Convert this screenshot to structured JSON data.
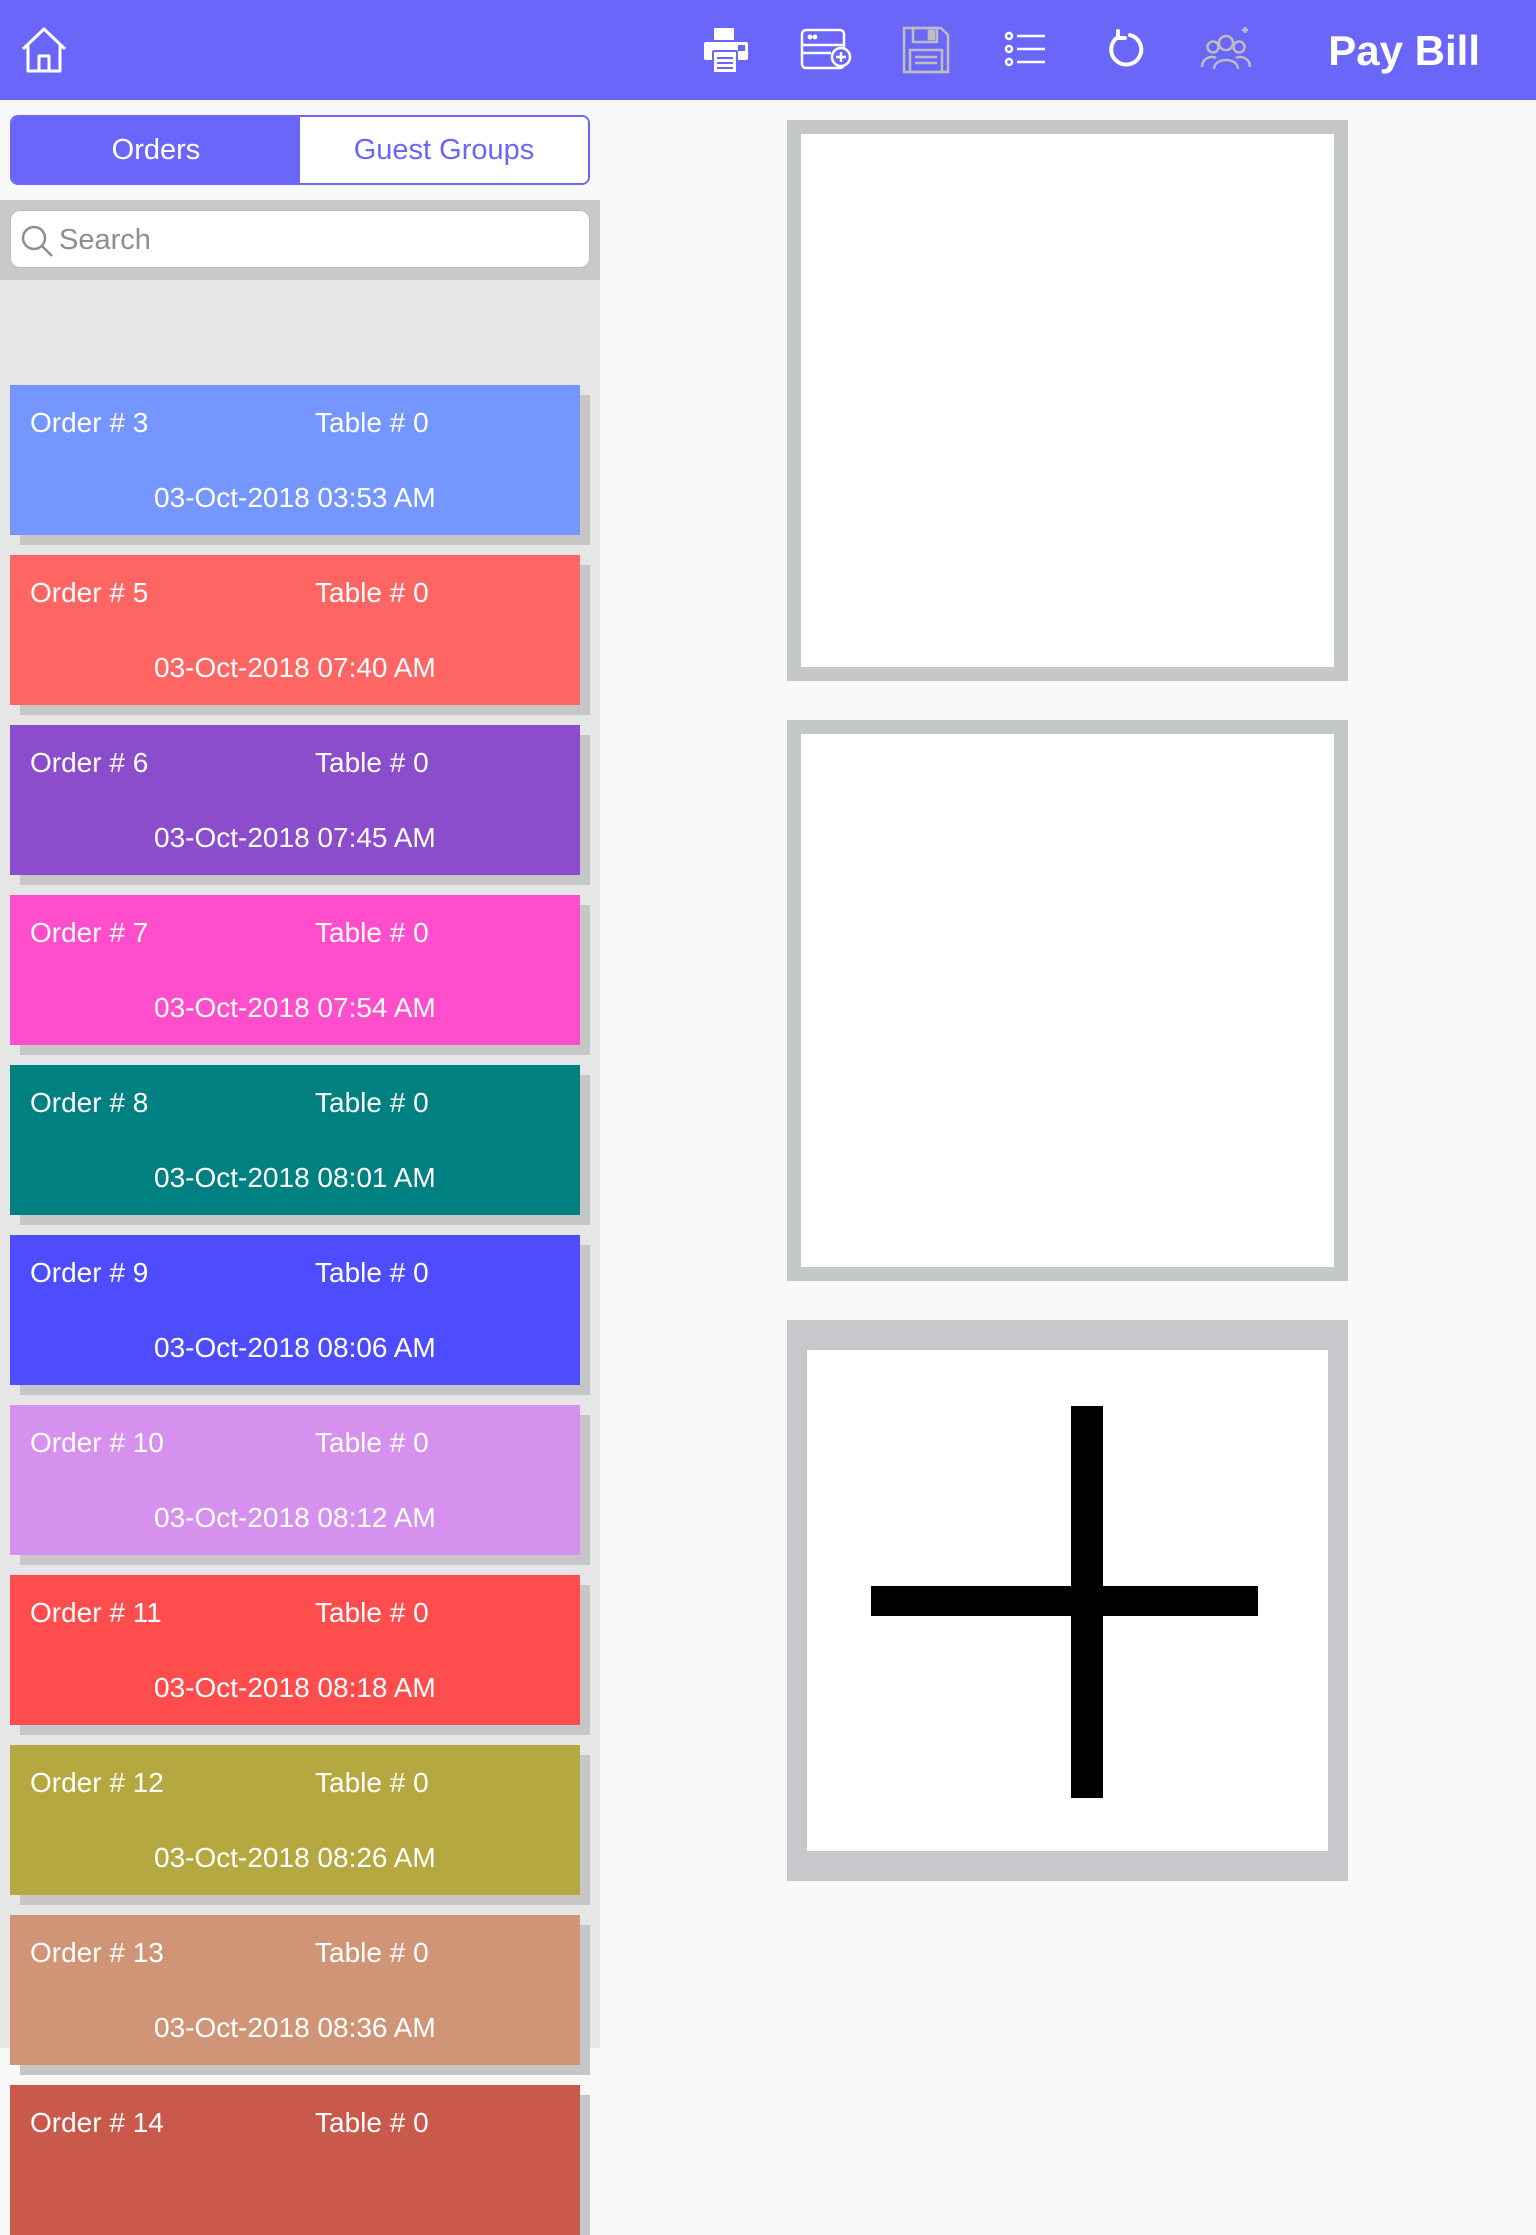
{
  "header": {
    "title": "Pay Bill",
    "icons": [
      "home-icon",
      "printer-icon",
      "add-window-icon",
      "save-icon",
      "list-icon",
      "refresh-icon",
      "guests-icon"
    ],
    "color": "#6b66fa"
  },
  "segment": {
    "orders_label": "Orders",
    "guest_groups_label": "Guest Groups",
    "selected": "Orders"
  },
  "search": {
    "placeholder": "Search",
    "value": ""
  },
  "orders": [
    {
      "order": "Order # 3",
      "table": "Table # 0",
      "datetime": "03-Oct-2018 03:53 AM",
      "color": "#7596ff"
    },
    {
      "order": "Order # 5",
      "table": "Table # 0",
      "datetime": "03-Oct-2018 07:40 AM",
      "color": "#ff6663"
    },
    {
      "order": "Order # 6",
      "table": "Table # 0",
      "datetime": "03-Oct-2018 07:45 AM",
      "color": "#8c4dcc"
    },
    {
      "order": "Order # 7",
      "table": "Table # 0",
      "datetime": "03-Oct-2018 07:54 AM",
      "color": "#ff4dcc"
    },
    {
      "order": "Order # 8",
      "table": "Table # 0",
      "datetime": "03-Oct-2018 08:01 AM",
      "color": "#008080"
    },
    {
      "order": "Order # 9",
      "table": "Table # 0",
      "datetime": "03-Oct-2018 08:06 AM",
      "color": "#4d4dff"
    },
    {
      "order": "Order # 10",
      "table": "Table # 0",
      "datetime": "03-Oct-2018 08:12 AM",
      "color": "#d690ed"
    },
    {
      "order": "Order # 11",
      "table": "Table # 0",
      "datetime": "03-Oct-2018 08:18 AM",
      "color": "#ff4d4d"
    },
    {
      "order": "Order # 12",
      "table": "Table # 0",
      "datetime": "03-Oct-2018 08:26 AM",
      "color": "#b5a841"
    },
    {
      "order": "Order # 13",
      "table": "Table # 0",
      "datetime": "03-Oct-2018 08:36 AM",
      "color": "#d09577"
    },
    {
      "order": "Order # 14",
      "table": "Table # 0",
      "datetime": "",
      "color": "#c9594a"
    }
  ],
  "tiles": [
    "blank",
    "blank",
    "add"
  ]
}
